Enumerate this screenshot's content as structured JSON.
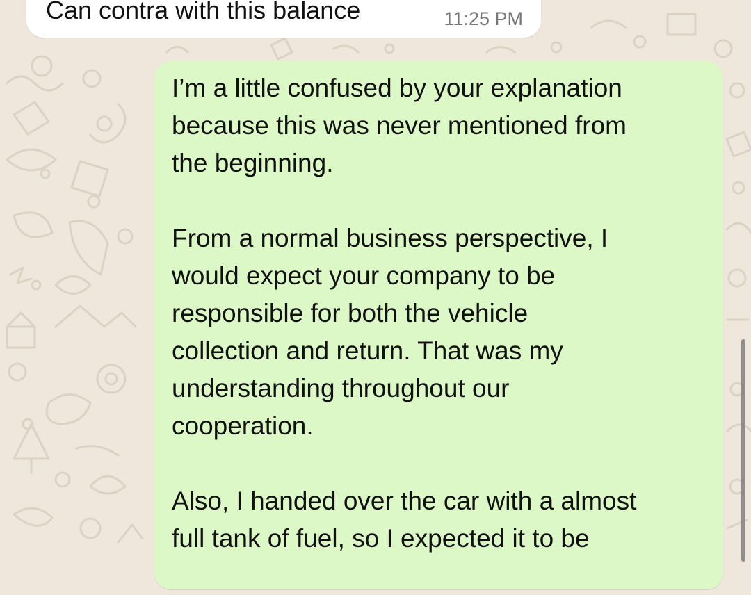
{
  "chat": {
    "incoming": {
      "text": "Can contra with this balance",
      "time": "11:25 PM"
    },
    "outgoing": {
      "paragraphs": [
        "I’m a little confused by your explanation\nbecause this was never mentioned from\nthe beginning.",
        "From a normal business perspective, I\nwould expect your company to be\nresponsible for both the vehicle\ncollection and return. That was my\nunderstanding throughout our\ncooperation.",
        "Also, I handed over the car with a almost\nfull tank of fuel, so I expected it to be"
      ]
    }
  },
  "colors": {
    "background": "#efe7dc",
    "incoming_bubble": "#ffffff",
    "outgoing_bubble": "#dcf8c6",
    "text": "#111111",
    "timestamp": "#777777"
  },
  "icons": {
    "background_doodles": "doodle-pattern"
  }
}
